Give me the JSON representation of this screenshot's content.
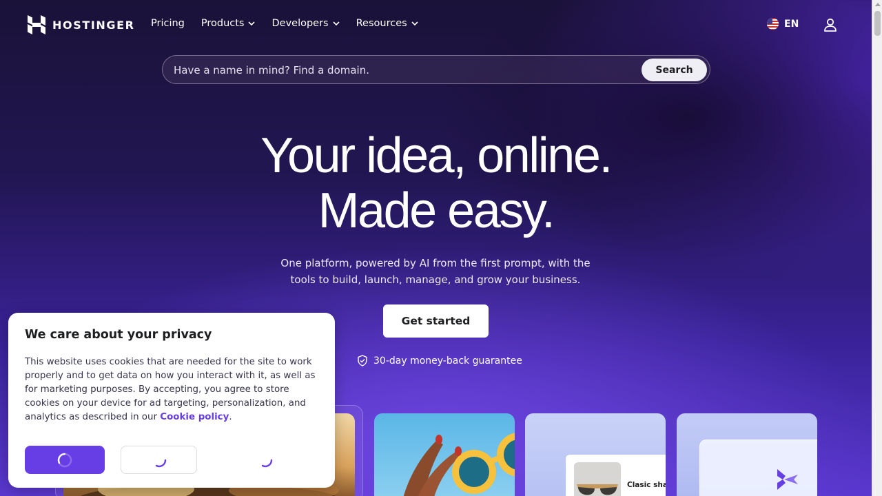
{
  "nav": {
    "brand": "HOSTINGER",
    "links": [
      {
        "label": "Pricing",
        "dropdown": false
      },
      {
        "label": "Products",
        "dropdown": true
      },
      {
        "label": "Developers",
        "dropdown": true
      },
      {
        "label": "Resources",
        "dropdown": true
      }
    ],
    "language": "EN"
  },
  "search": {
    "placeholder": "Have a name in mind? Find a domain.",
    "button": "Search"
  },
  "hero": {
    "title_line1": "Your idea, online.",
    "title_line2": "Made easy.",
    "subtitle": "One platform, powered by AI from the first prompt, with the tools to build, launch, manage, and grow your business.",
    "cta": "Get started",
    "guarantee": "30-day money-back guarantee"
  },
  "cards": {
    "card3_label": "Clasic shad"
  },
  "cookie": {
    "title": "We care about your privacy",
    "body": "This website uses cookies that are needed for the site to work properly and to get data on how you interact with it, as well as for marketing purposes. By accepting, you agree to store cookies on your device for ad targeting, personalization, and analytics as described in our ",
    "link": "Cookie policy",
    "suffix": "."
  },
  "colors": {
    "brand_purple": "#673de6",
    "background_dark": "#1d1440"
  }
}
